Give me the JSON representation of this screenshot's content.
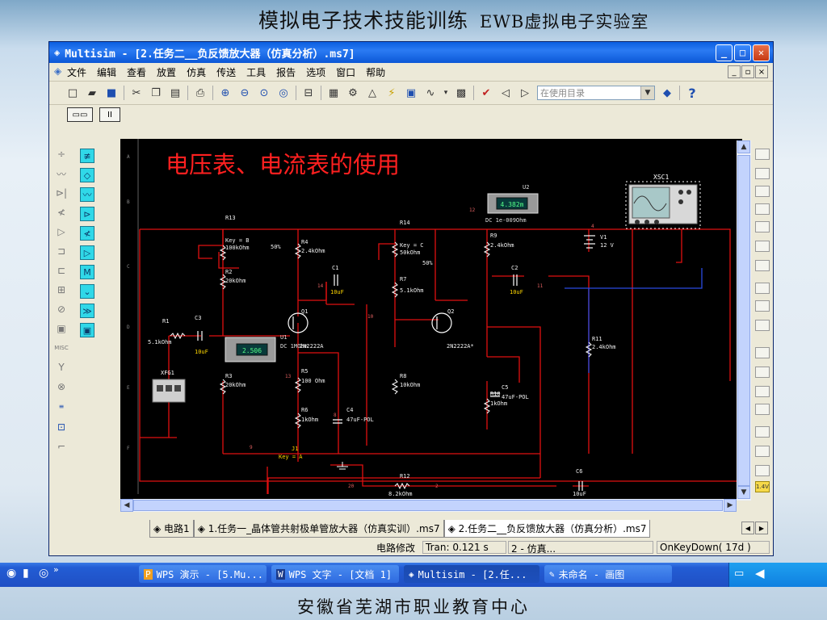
{
  "slide": {
    "title": "模拟电子技术技能训练",
    "lab": "EWB虚拟电子实验室",
    "footer": "安徽省芜湖市职业教育中心"
  },
  "window": {
    "title": "Multisim - [2.任务二__负反馈放大器（仿真分析）.ms7]",
    "minimize": "_",
    "maximize": "□",
    "close": "✕"
  },
  "menu": [
    "文件",
    "编辑",
    "查看",
    "放置",
    "仿真",
    "传送",
    "工具",
    "报告",
    "选项",
    "窗口",
    "帮助"
  ],
  "mdi_controls": [
    "_",
    "▫",
    "×"
  ],
  "toolbar": {
    "combo_placeholder": "在使用目录",
    "help": "?"
  },
  "simbar": {
    "run": "▭▭",
    "pause": "II"
  },
  "schematic": {
    "heading": "电压表、电流表的使用",
    "voltmeter_reading": "4.382m",
    "voltmeter_label": "U2",
    "voltmeter_mode": "DC  1e-009Ohm",
    "ammeter_reading": "2.506",
    "ammeter_label": "U1",
    "ammeter_mode": "DC  1MOhm",
    "scope_label": "XSC1",
    "fgen_label": "XFG1",
    "parts": {
      "r13": "R13",
      "r13_key": "Key = B",
      "r13_val": "100kOhm",
      "r13_pct": "50%",
      "r4": "R4",
      "r4_val": "2.4kOhm",
      "r14": "R14",
      "r14_key": "Key = C",
      "r14_val": "50kOhm",
      "r14_pct": "50%",
      "r9": "R9",
      "r9_val": "2.4kOhm",
      "v1": "V1",
      "v1_val": "12 V",
      "c1": "C1",
      "c1_val": "10uF",
      "c2": "C2",
      "c2_val": "10uF",
      "r2": "R2",
      "r2_val": "20kOhm",
      "r7": "R7",
      "r7_val": "5.1kOhm",
      "r1": "R1",
      "r1_val": "5.1kOhm",
      "c3": "C3",
      "c3_val": "10uF",
      "q1": "Q1",
      "q1_model": "2N2222A",
      "q2": "Q2",
      "q2_model": "2N2222A*",
      "r11": "R11",
      "r11_val": "2.4kOhm",
      "r3": "R3",
      "r3_val": "20kOhm",
      "r5": "R5",
      "r5_val": "100 Ohm",
      "r8": "R8",
      "r8_val": "10kOhm",
      "r10": "R10",
      "r10_val": "1kOhm",
      "c5": "C5",
      "c5_val": "47uF-POL",
      "r6": "R6",
      "r6_val": "1kOhm",
      "c4": "C4",
      "c4_val": "47uF-POL",
      "j1": "J1",
      "j1_key": "Key = A",
      "r12": "R12",
      "r12_val": "8.2kOhm",
      "c6": "C6",
      "c6_val": "10uF"
    },
    "nodes": [
      "12",
      "14",
      "10",
      "11",
      "4",
      "13",
      "8",
      "9",
      "2",
      "20"
    ],
    "rows": [
      "A",
      "B",
      "C",
      "D",
      "E",
      "F"
    ]
  },
  "doc_tabs": [
    "电路1",
    "1.任务一_晶体管共射极单管放大器（仿真实训）.ms7",
    "2.任务二__负反馈放大器（仿真分析）.ms7"
  ],
  "status": {
    "edit": "电路修改",
    "tran": "Tran: 0.121 s",
    "sim": "2 - 仿真...",
    "key": "OnKeyDown( 17d )"
  },
  "taskbar": {
    "items": [
      "WPS 演示 - [5.Mu...",
      "WPS 文字 - [文档 1]",
      "Multisim - [2.任...",
      "未命名 - 画图"
    ],
    "chevron": "»"
  },
  "colors": {
    "wire_red": "#e01010",
    "wire_blue": "#2a4ae0",
    "heading_red": "#ff2020",
    "canvas": "#000000",
    "xp_blue": "#235dd4"
  }
}
